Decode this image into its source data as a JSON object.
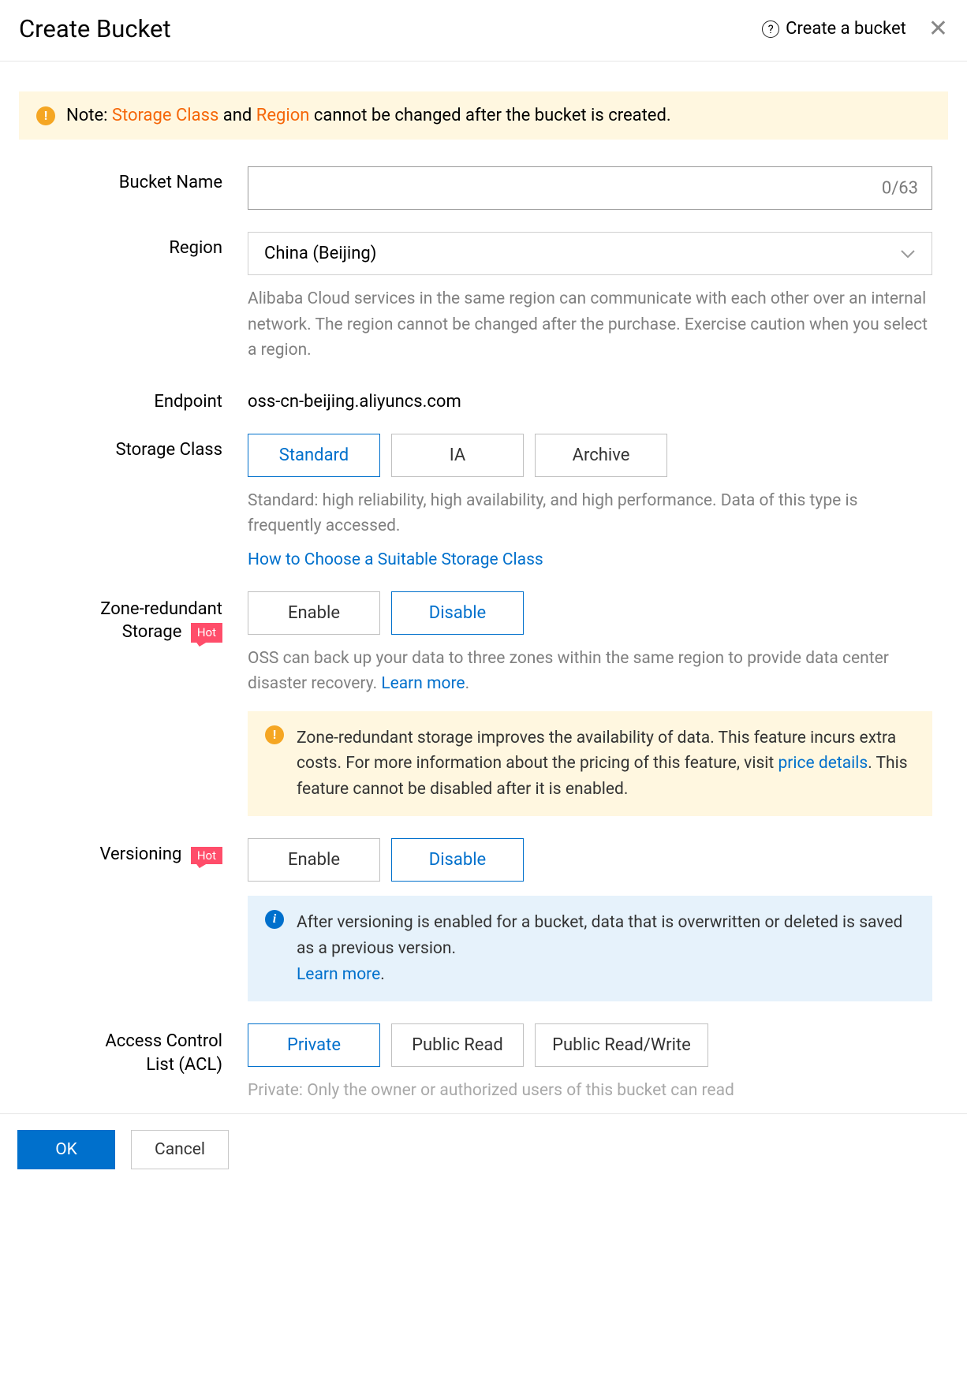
{
  "header": {
    "title": "Create Bucket",
    "help_text": "Create a bucket"
  },
  "note": {
    "prefix": "Note:",
    "hl1": "Storage Class",
    "mid": "and",
    "hl2": "Region",
    "suffix": "cannot be changed after the bucket is created."
  },
  "form": {
    "bucket_name": {
      "label": "Bucket Name",
      "counter": "0/63"
    },
    "region": {
      "label": "Region",
      "value": "China (Beijing)",
      "help": "Alibaba Cloud services in the same region can communicate with each other over an internal network. The region cannot be changed after the purchase. Exercise caution when you select a region."
    },
    "endpoint": {
      "label": "Endpoint",
      "value": "oss-cn-beijing.aliyuncs.com"
    },
    "storage_class": {
      "label": "Storage Class",
      "options": [
        "Standard",
        "IA",
        "Archive"
      ],
      "help": "Standard: high reliability, high availability, and high performance. Data of this type is frequently accessed.",
      "link": "How to Choose a Suitable Storage Class"
    },
    "zrs": {
      "label_line1": "Zone-redundant",
      "label_line2": "Storage",
      "hot": "Hot",
      "options": [
        "Enable",
        "Disable"
      ],
      "help_pre": "OSS can back up your data to three zones within the same region to provide data center disaster recovery. ",
      "help_link": "Learn more",
      "banner_pre": "Zone-redundant storage improves the availability of data. This feature incurs extra costs. For more information about the pricing of this feature, visit ",
      "banner_link": "price details",
      "banner_post": ". This feature cannot be disabled after it is enabled."
    },
    "versioning": {
      "label": "Versioning",
      "hot": "Hot",
      "options": [
        "Enable",
        "Disable"
      ],
      "banner_text": "After versioning is enabled for a bucket, data that is overwritten or deleted is saved as a previous version. ",
      "banner_link": "Learn more"
    },
    "acl": {
      "label_line1": "Access Control",
      "label_line2": "List (ACL)",
      "options": [
        "Private",
        "Public Read",
        "Public Read/Write"
      ],
      "help": "Private: Only the owner or authorized users of this bucket can read"
    }
  },
  "footer": {
    "ok": "OK",
    "cancel": "Cancel"
  }
}
